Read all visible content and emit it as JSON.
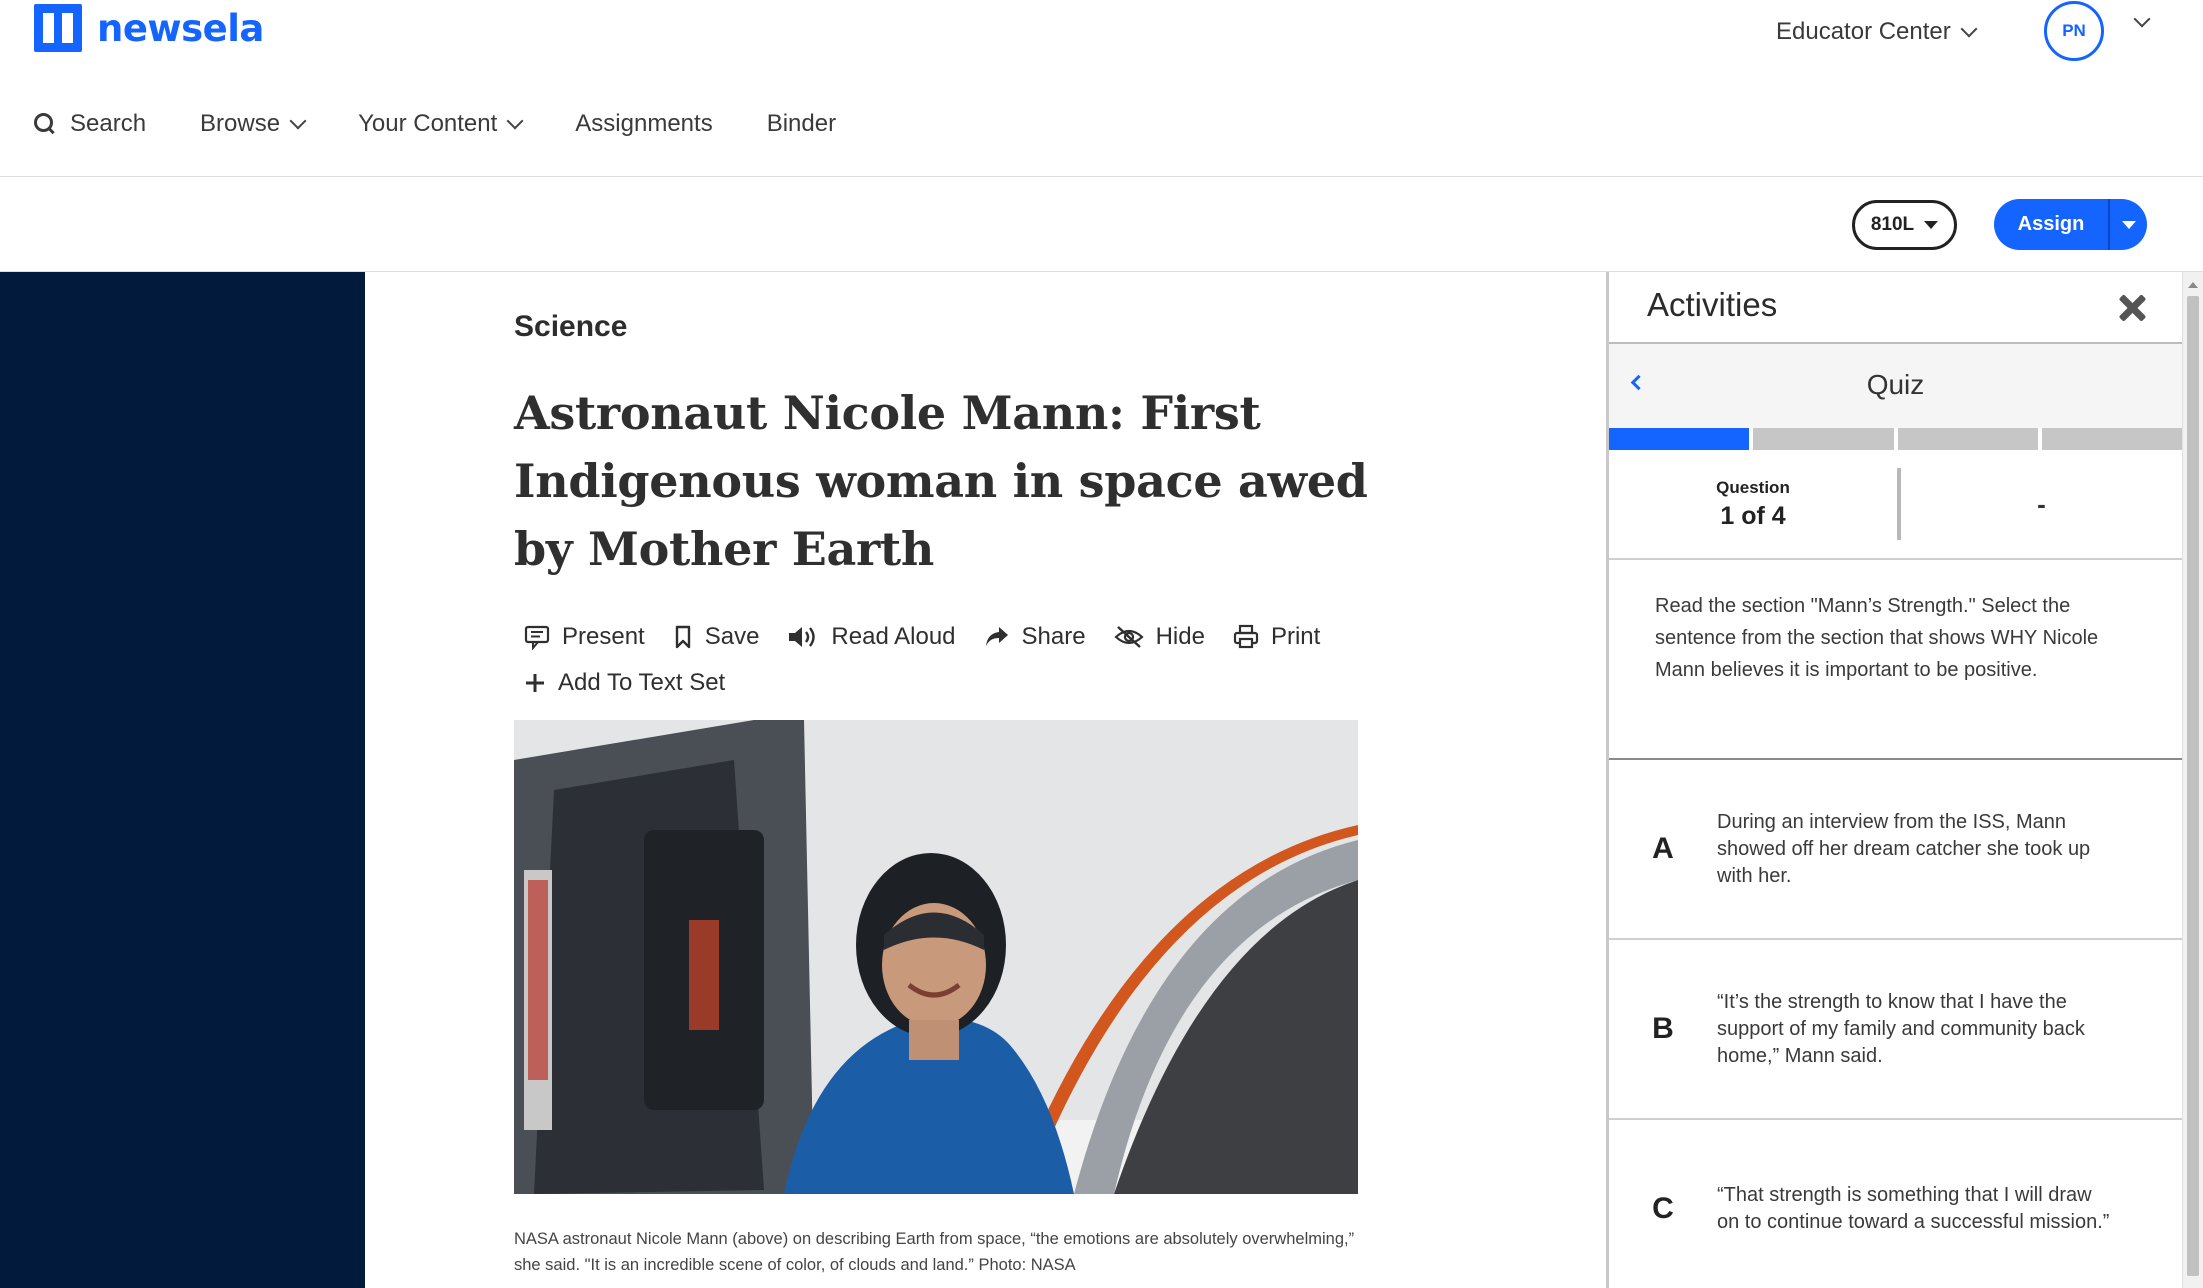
{
  "brand": {
    "name": "newsela",
    "color": "#1464ff"
  },
  "header": {
    "educator_center": "Educator Center",
    "avatar_initials": "PN",
    "nav": {
      "search": "Search",
      "browse": "Browse",
      "your_content": "Your Content",
      "assignments": "Assignments",
      "binder": "Binder"
    }
  },
  "subbar": {
    "lexile": "810L",
    "assign": "Assign"
  },
  "article": {
    "subject": "Science",
    "headline": "Astronaut Nicole Mann: First Indigenous woman in space awed by Mother Earth",
    "actions": {
      "present": "Present",
      "save": "Save",
      "read_aloud": "Read Aloud",
      "share": "Share",
      "hide": "Hide",
      "print": "Print",
      "add_to_text_set": "Add To Text Set"
    },
    "caption": "NASA astronaut Nicole Mann (above) on describing Earth from space, “the emotions are absolutely overwhelming,” she said. \"It is an incredible scene of color, of clouds and land.” Photo: NASA"
  },
  "activities": {
    "title": "Activities",
    "quiz_title": "Quiz",
    "progress": {
      "current": 1,
      "total": 4
    },
    "question_label": "Question",
    "question_value": "1 of 4",
    "score_placeholder": "-",
    "prompt": "Read the section \"Mann’s Strength.\" Select the sentence from the section that shows WHY Nicole Mann believes it is important to be positive.",
    "choices": [
      {
        "letter": "A",
        "text": "During an interview from the ISS, Mann showed off her dream catcher she took up with her."
      },
      {
        "letter": "B",
        "text": "“It’s the strength to know that I have the support of my family and community back home,” Mann said."
      },
      {
        "letter": "C",
        "text": "“That strength is something that I will draw on to continue toward a successful mission.”"
      }
    ]
  }
}
